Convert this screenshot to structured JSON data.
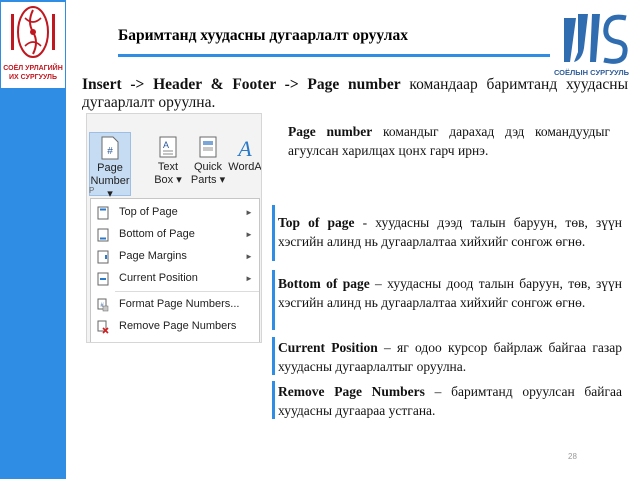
{
  "header": {
    "title": "Баримтанд хуудасны дугаарлалт оруулах",
    "left_logo_text": "СОЁЛ УРЛАГИЙН ИХ СУРГУУЛЬ",
    "right_logo_text": "СОЁЛЫН СУРГУУЛЬ"
  },
  "intro": {
    "keyword": "Insert -> Header & Footer -> Page number",
    "text": " командаар баримтанд хуудасны дугаарлалт оруулна."
  },
  "ribbon": {
    "buttons": [
      {
        "label_line1": "Page",
        "label_line2": "Number ▾"
      },
      {
        "label_line1": "Text",
        "label_line2": "Box ▾"
      },
      {
        "label_line1": "Quick",
        "label_line2": "Parts ▾"
      },
      {
        "label_line1": "WordA",
        "label_line2": ""
      }
    ]
  },
  "menu": {
    "items": [
      {
        "label": "Top of Page",
        "arrow": "►"
      },
      {
        "label": "Bottom of Page",
        "arrow": "►"
      },
      {
        "label": "Page Margins",
        "arrow": "►"
      },
      {
        "label": "Current Position",
        "arrow": "►"
      },
      {
        "label": "Format Page Numbers...",
        "arrow": ""
      },
      {
        "label": "Remove Page Numbers",
        "arrow": ""
      }
    ]
  },
  "desc": {
    "p1_kw": "Page number",
    "p1_text": " командыг дарахад дэд командуудыг агуулсан харилцах цонх гарч ирнэ.",
    "p2_kw": "Top of page",
    "p2_text": " - хуудасны дээд талын баруун, төв, зүүн хэсгийн алинд нь дугаарлалтаа хийхийг сонгож өгнө.",
    "p3_kw": "Bottom of page",
    "p3_text": " – хуудасны доод талын баруун, төв, зүүн хэсгийн алинд нь дугаарлалтаа хийхийг сонгож өгнө.",
    "p4_kw": "Current Position",
    "p4_text": " – яг одоо курсор байрлаж байгаа газар хуудасны дугаарлалтыг оруулна.",
    "p5_kw": "Remove Page Numbers",
    "p5_text": " – баримтанд оруулсан байгаа хуудасны дугаараа устгана."
  },
  "footer": {
    "page_number": "28"
  },
  "colors": {
    "accent": "#2f8de4",
    "logo_red": "#c01820",
    "ribbon_active": "#c5dcf2"
  }
}
